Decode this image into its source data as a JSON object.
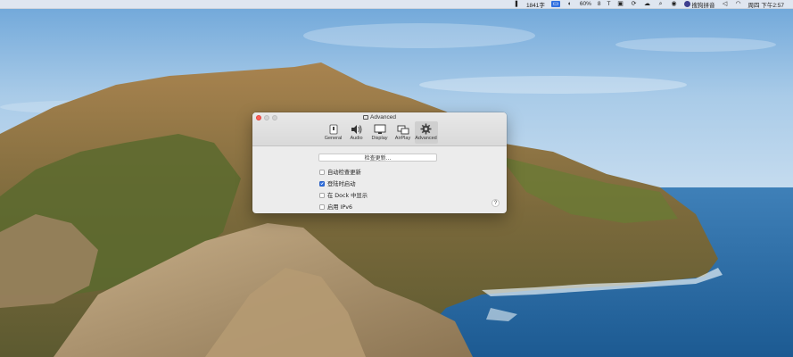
{
  "menubar": {
    "items": [
      {
        "icon": "bookmark-icon",
        "label": ""
      },
      {
        "icon": "",
        "label": "1841字"
      },
      {
        "icon": "display-icon",
        "label": ""
      },
      {
        "icon": "cursor-icon",
        "label": ""
      },
      {
        "icon": "speed-icon",
        "label": ""
      },
      {
        "icon": "",
        "label": "60%"
      },
      {
        "icon": "",
        "label": "8"
      },
      {
        "icon": "",
        "label": "T"
      },
      {
        "icon": "",
        "label": "📷"
      }
    ],
    "input_method": "搜狗拼音",
    "clock": "周四 下午2:57"
  },
  "window": {
    "title": "Advanced",
    "tabs": [
      {
        "label": "General",
        "icon": "switch-icon"
      },
      {
        "label": "Audio",
        "icon": "speaker-icon"
      },
      {
        "label": "Display",
        "icon": "monitor-icon"
      },
      {
        "label": "AirPlay",
        "icon": "airplay-screens-icon"
      },
      {
        "label": "Advanced",
        "icon": "gear-icon"
      }
    ],
    "check_update_label": "检查更新...",
    "options": [
      {
        "label": "自动检查更新",
        "checked": false
      },
      {
        "label": "登陆时启动",
        "checked": true
      },
      {
        "label": "在 Dock 中显示",
        "checked": false
      },
      {
        "label": "启用 IPv6",
        "checked": false
      }
    ],
    "help_label": "?"
  }
}
